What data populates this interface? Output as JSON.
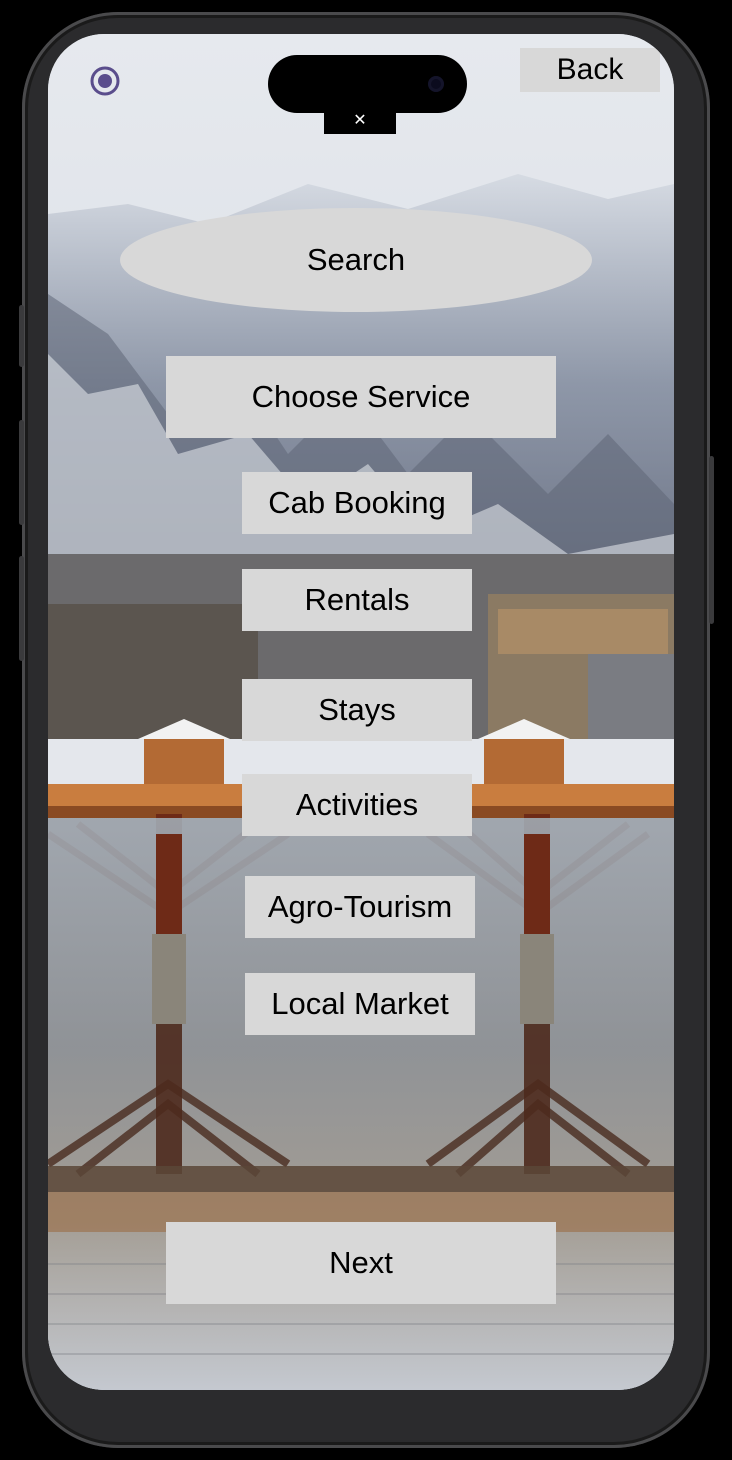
{
  "header": {
    "back_label": "Back"
  },
  "search": {
    "label": "Search"
  },
  "choose_service": {
    "label": "Choose Service"
  },
  "services": [
    {
      "label": "Cab Booking"
    },
    {
      "label": "Rentals"
    },
    {
      "label": "Stays"
    },
    {
      "label": "Activities"
    },
    {
      "label": "Agro-Tourism"
    },
    {
      "label": "Local Market"
    }
  ],
  "footer": {
    "next_label": "Next"
  },
  "icons": {
    "top_left": "radio-button-icon"
  },
  "colors": {
    "button_bg": "#d8d8d8",
    "radio_accent": "#5a4d8c"
  }
}
